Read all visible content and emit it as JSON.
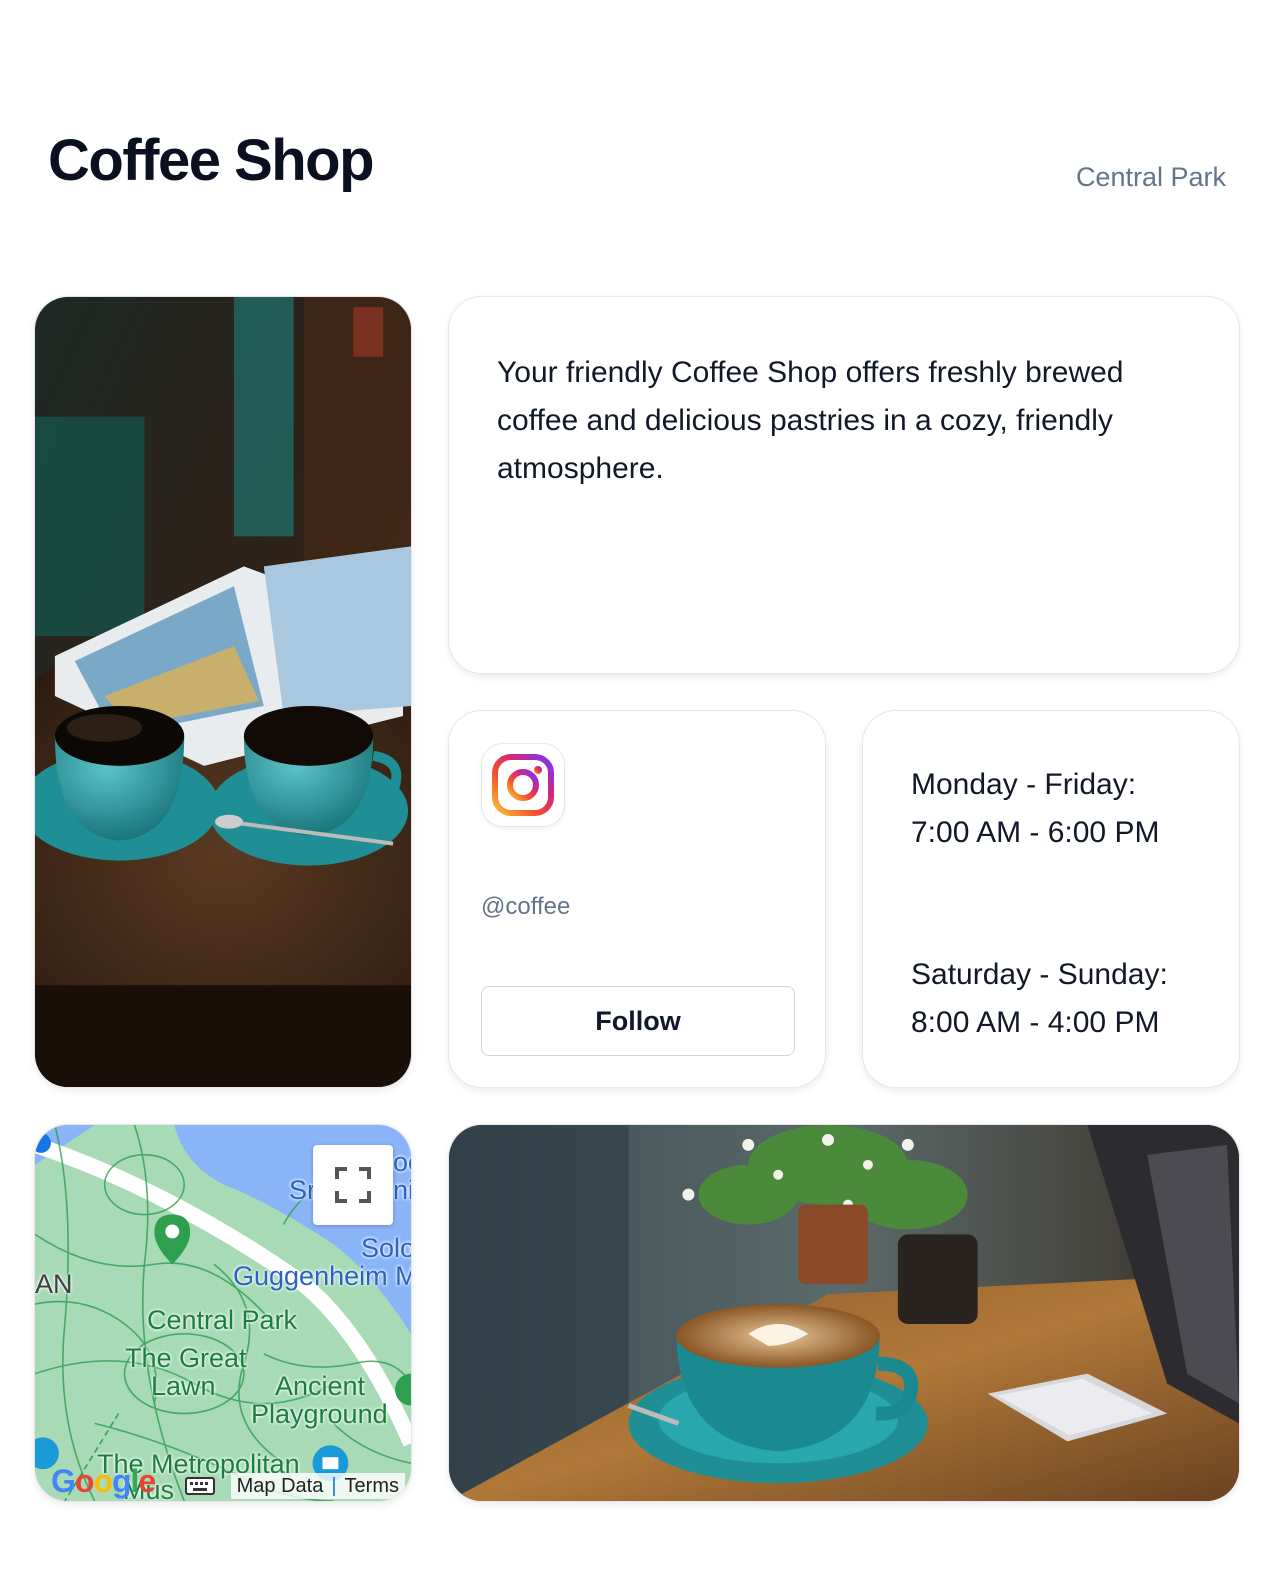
{
  "header": {
    "title": "Coffee Shop",
    "location": "Central Park"
  },
  "about": {
    "text": "Your friendly Coffee Shop offers freshly brewed coffee and delicious pastries in a cozy, friendly atmosphere."
  },
  "instagram": {
    "icon": "instagram-icon",
    "handle": "@coffee",
    "follow_label": "Follow"
  },
  "hours": {
    "weekday_label": "Monday - Friday:",
    "weekday_time": "7:00 AM - 6:00 PM",
    "weekend_label": "Saturday - Sunday:",
    "weekend_time": "8:00 AM - 4:00 PM"
  },
  "map": {
    "labels": {
      "central_park": "Central Park",
      "great_lawn_1": "The Great",
      "great_lawn_2": "Lawn",
      "ancient_1": "Ancient",
      "ancient_2": "Playground",
      "guggenheim": "Guggenheim M",
      "solo": "Solo",
      "sr": "Sr",
      "met_1": "The Metropolitan",
      "met_2": "Mus",
      "an": "AN",
      "oo": "oo",
      "ni": "ni"
    },
    "google": "Google",
    "map_data": "Map Data",
    "terms": "Terms"
  },
  "colors": {
    "title": "#0b1020",
    "muted": "#64748b",
    "park": "#a8dab5",
    "water": "#8ab4f8",
    "road": "#ffffff"
  }
}
